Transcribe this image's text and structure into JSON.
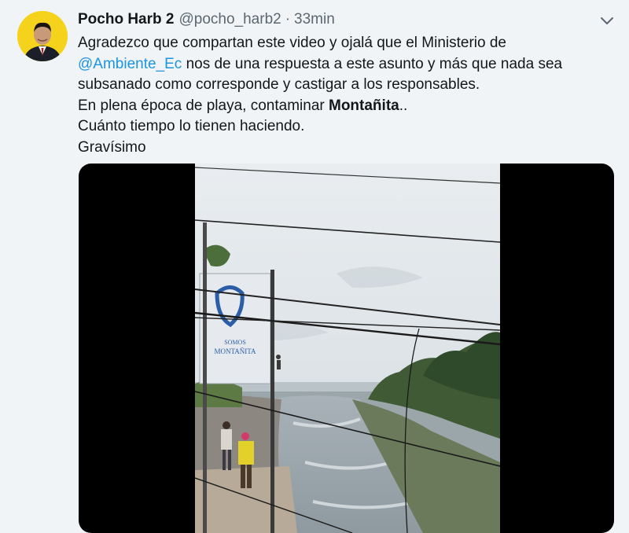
{
  "tweet": {
    "display_name": "Pocho Harb 2",
    "handle": "@pocho_harb2",
    "separator": "·",
    "time": "33min",
    "text_lines": [
      {
        "plain": "Agradezco que compartan este video y ojalá que el Ministerio de"
      },
      {
        "mention": "@Ambiente_Ec",
        "plain": " nos de una respuesta a este asunto y más que nada sea"
      },
      {
        "plain": "subsanado como corresponde y castigar a los responsables."
      },
      {
        "plain": "En plena época de playa, contaminar ",
        "bold": "Montañita",
        "tail": ".."
      },
      {
        "plain": "Cuánto tiempo lo tienen haciendo."
      },
      {
        "plain": "Gravísimo"
      }
    ]
  },
  "media": {
    "banner_brand_top": "SOMOS",
    "banner_brand_bottom": "MONTAÑITA"
  },
  "colors": {
    "link": "#1b95e0",
    "avatar_bg": "#f5d21b",
    "meta_text": "#5b6770"
  }
}
